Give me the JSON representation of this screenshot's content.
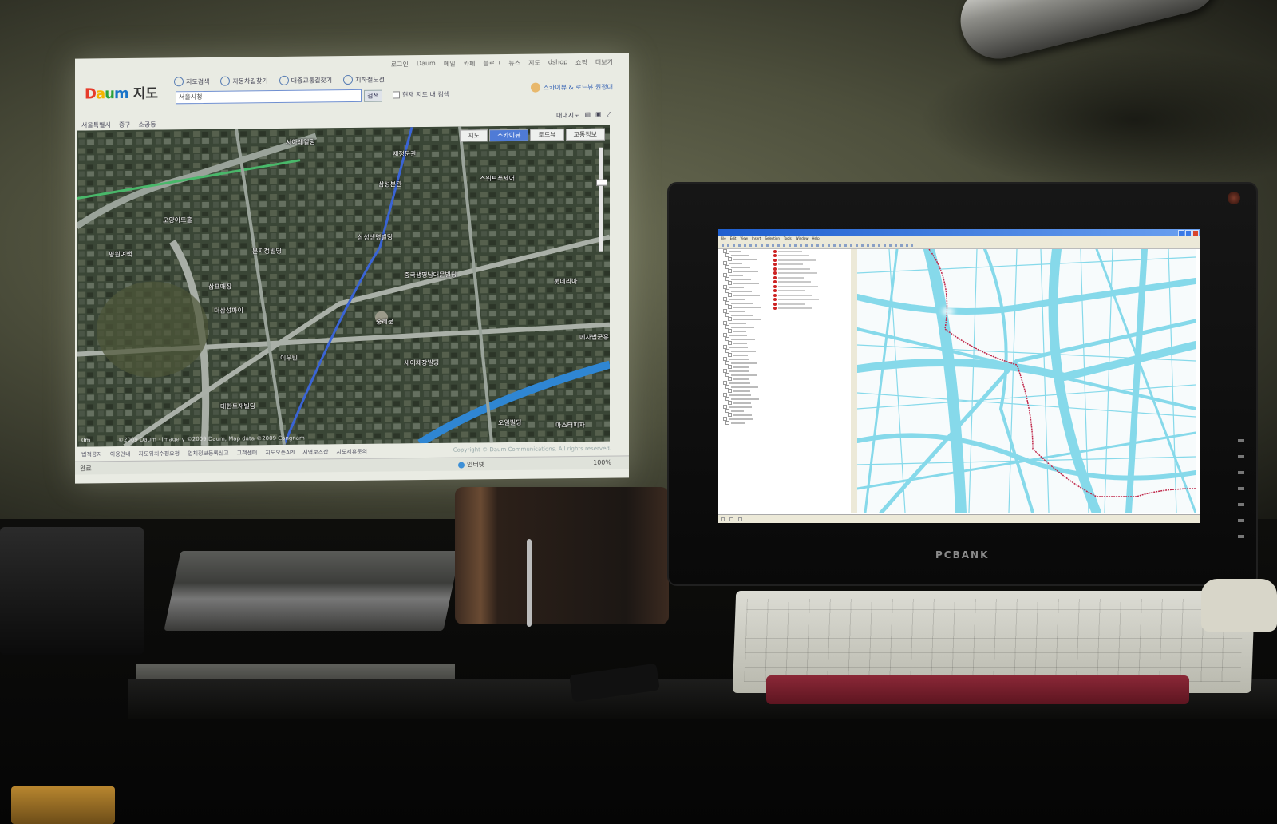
{
  "projection": {
    "top_nav": [
      "로그인",
      "Daum",
      "메일",
      "카페",
      "블로그",
      "뉴스",
      "지도",
      "dshop",
      "쇼핑",
      "더보기"
    ],
    "logo_text": "Daum",
    "logo_title": "지도",
    "tabs": [
      "지도검색",
      "자동차길찾기",
      "대중교통길찾기",
      "지하철노선"
    ],
    "search_value": "서울시청",
    "search_button": "검색",
    "checkbox_label": "현재 지도 내 검색",
    "promo": "스카이뷰 & 로드뷰 원정대",
    "location": [
      "서울특별시",
      "중구",
      "소공동"
    ],
    "map_toolbar": "대대지도",
    "modes": [
      "지도",
      "스카이뷰",
      "로드뷰",
      "교통정보"
    ],
    "active_mode": "스카이뷰",
    "map_labels": [
      "시아레일딩",
      "재정문관",
      "삼성본관",
      "스위트푸세어",
      "오양아트홀",
      "삼성생명빌딩",
      "본지정빌딩",
      "중국생명남대문빌딩",
      "삼표매장",
      "롯데리아",
      "더삼성파이",
      "숭례문",
      "메사법군흥",
      "이우빈",
      "세이체장빌딩",
      "대한트재빌딩",
      "오일빌딩",
      "마스터피자",
      "평원여맥"
    ],
    "map_scale": "0m",
    "map_copyright": "©2009 Daum · Imagery ©2009 Daum, Map data ©2009 Congnam",
    "footer_links": [
      "법적공지",
      "이용안내",
      "지도위치수정요청",
      "업체정보등록신고",
      "고객센터",
      "지도오픈API",
      "지역보즈샵",
      "지도제휴문의"
    ],
    "copyright": "Copyright © Daum Communications. All rights reserved.",
    "status_left": "완료",
    "status_zone": "인터넷",
    "status_zoom": "100%"
  },
  "monitor": {
    "brand": "PCBANK",
    "gis_menu": [
      "File",
      "Edit",
      "View",
      "Insert",
      "Selection",
      "Tools",
      "Window",
      "Help"
    ],
    "toc_rows": 44,
    "table_rows": 14
  },
  "colors": {
    "gis_roads": "#86d9ea",
    "gis_route": "#c0284a",
    "daum_blue": "#1a74c8",
    "wrist_rest": "#8b2837"
  }
}
